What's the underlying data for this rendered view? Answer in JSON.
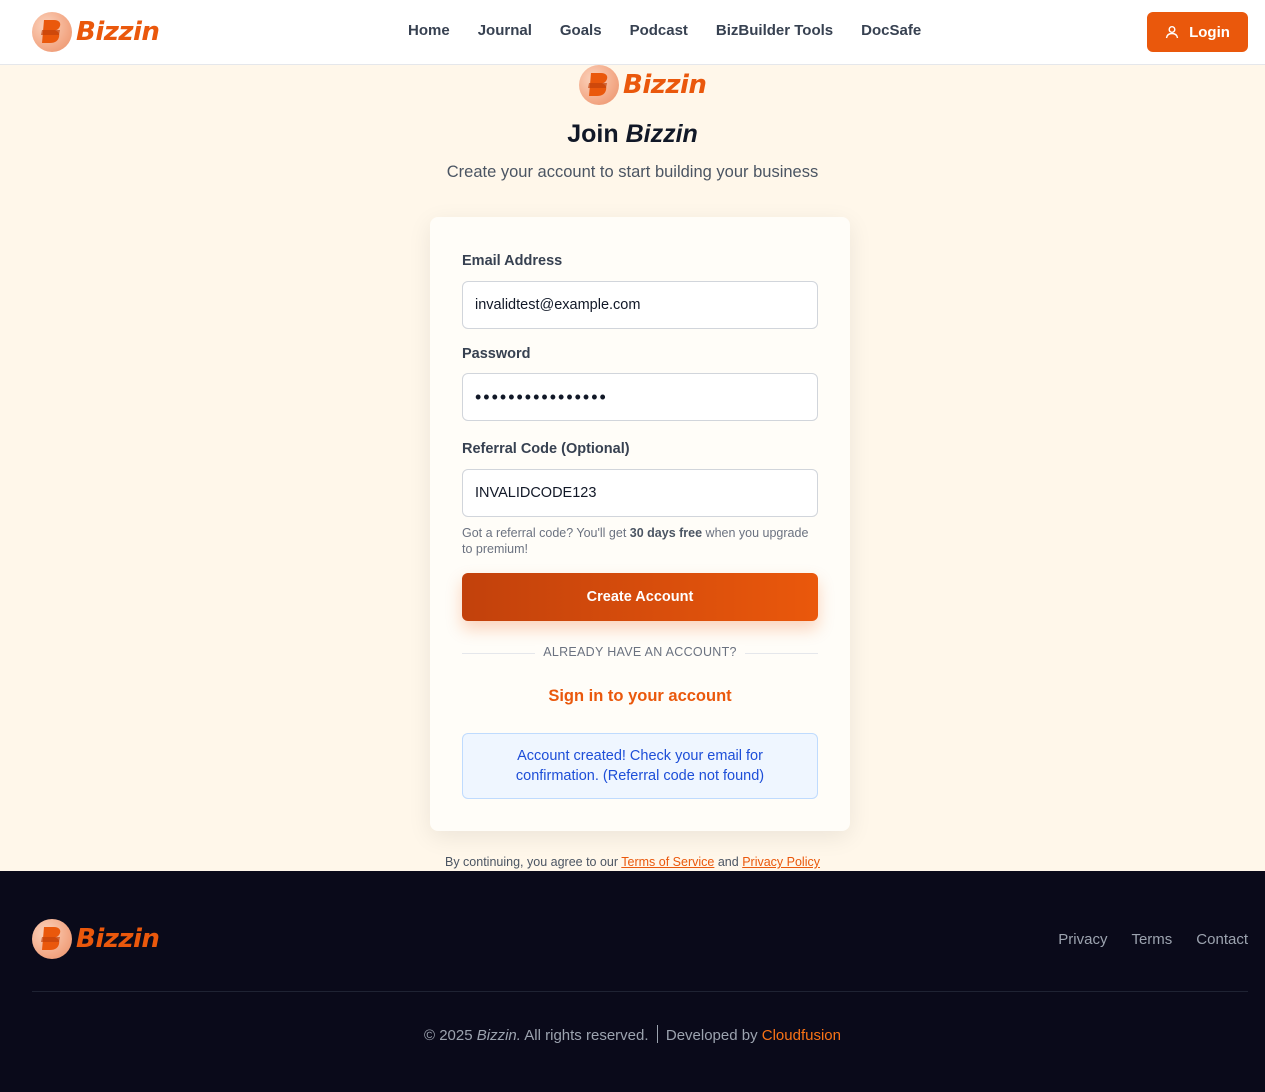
{
  "brand": {
    "name": "Bizzin",
    "color": "#ea580c"
  },
  "header": {
    "nav": [
      "Home",
      "Journal",
      "Goals",
      "Podcast",
      "BizBuilder Tools",
      "DocSafe"
    ],
    "login_label": "Login"
  },
  "hero": {
    "title_prefix": "Join",
    "title_brand": "Bizzin",
    "subtitle": "Create your account to start building your business"
  },
  "form": {
    "email_label": "Email Address",
    "email_value": "invalidtest@example.com",
    "password_label": "Password",
    "password_value": "••••••••••••••••",
    "referral_label": "Referral Code (Optional)",
    "referral_value": "INVALIDCODE123",
    "hint_prefix": "Got a referral code? You'll get ",
    "hint_bold": "30 days free",
    "hint_suffix": " when you upgrade to premium!",
    "submit_label": "Create Account",
    "divider_text": "ALREADY HAVE AN ACCOUNT?",
    "signin_label": "Sign in to your account",
    "notice": "Account created! Check your email for confirmation. (Referral code not found)"
  },
  "terms": {
    "prefix": "By continuing, you agree to our ",
    "tos": "Terms of Service",
    "and": " and ",
    "privacy": "Privacy Policy"
  },
  "footer": {
    "links": [
      "Privacy",
      "Terms",
      "Contact"
    ],
    "copyright_prefix": "© 2025 ",
    "copyright_brand": "Bizzin.",
    "copyright_suffix": " All rights reserved.",
    "developed_by": "Developed by ",
    "developer": "Cloudfusion"
  },
  "icons": {
    "login": "user-icon",
    "logo": "bizzin-logo-icon"
  }
}
